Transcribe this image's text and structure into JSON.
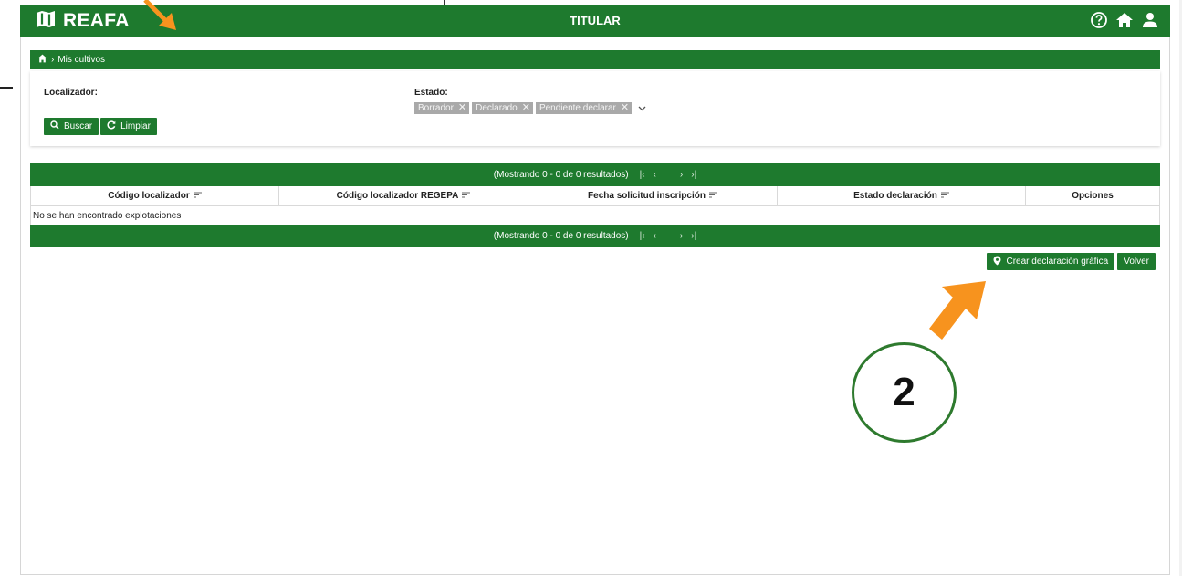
{
  "header": {
    "app_title": "REAFA",
    "section_title": "TITULAR",
    "icons": [
      "map-icon",
      "help-icon",
      "home-icon",
      "user-icon"
    ]
  },
  "breadcrumb": {
    "current": "Mis cultivos"
  },
  "filters": {
    "localizador_label": "Localizador:",
    "localizador_value": "",
    "estado_label": "Estado:",
    "estado_chips": [
      "Borrador",
      "Declarado",
      "Pendiente declarar"
    ],
    "search_label": "Buscar",
    "clear_label": "Limpiar"
  },
  "table": {
    "pager_text": "(Mostrando 0 - 0 de 0 resultados)",
    "columns": [
      "Código localizador",
      "Código localizador REGEPA",
      "Fecha solicitud inscripción",
      "Estado declaración",
      "Opciones"
    ],
    "empty_message": "No se han encontrado explotaciones"
  },
  "actions": {
    "create_label": "Crear declaración gráfica",
    "back_label": "Volver"
  },
  "annotation": {
    "step_number": "2"
  },
  "colors": {
    "primary": "#1e7a2e",
    "chip": "#a9a9a9",
    "callout": "#f7931e",
    "badge_border": "#2e7a2e"
  }
}
